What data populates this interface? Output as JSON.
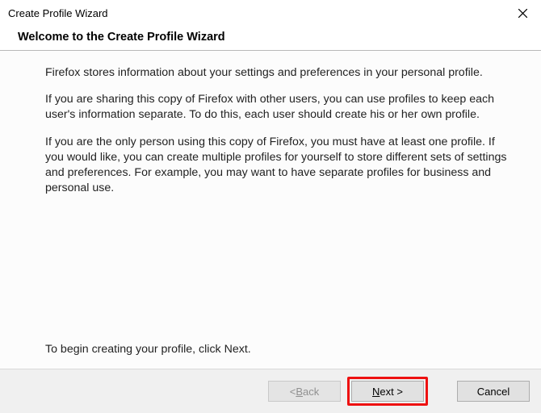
{
  "titlebar": {
    "title": "Create Profile Wizard"
  },
  "header": {
    "title": "Welcome to the Create Profile Wizard"
  },
  "body": {
    "p1": "Firefox stores information about your settings and preferences in your personal profile.",
    "p2": "If you are sharing this copy of Firefox with other users, you can use profiles to keep each user's information separate. To do this, each user should create his or her own profile.",
    "p3": "If you are the only person using this copy of Firefox, you must have at least one profile. If you would like, you can create multiple profiles for yourself to store different sets of settings and preferences. For example, you may want to have separate profiles for business and personal use.",
    "begin": "To begin creating your profile, click Next."
  },
  "buttons": {
    "back_prefix": "< ",
    "back_mnemonic": "B",
    "back_suffix": "ack",
    "next_mnemonic": "N",
    "next_suffix": "ext >",
    "cancel": "Cancel"
  }
}
